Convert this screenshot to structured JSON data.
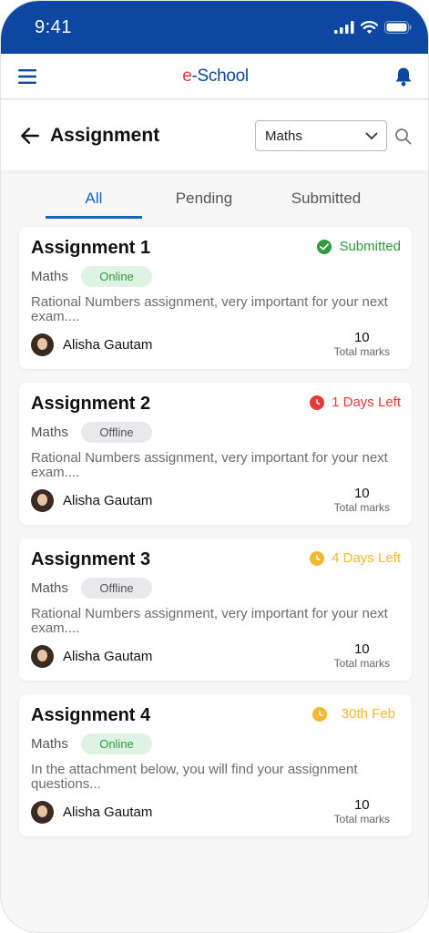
{
  "status_bar": {
    "time": "9:41"
  },
  "app": {
    "brand_e": "e",
    "brand_rest": "-School"
  },
  "header": {
    "title": "Assignment",
    "subject_select": "Maths"
  },
  "tabs": [
    {
      "label": "All",
      "active": true
    },
    {
      "label": "Pending",
      "active": false
    },
    {
      "label": "Submitted",
      "active": false
    }
  ],
  "assignments": [
    {
      "title": "Assignment 1",
      "status": "Submitted",
      "status_type": "submitted",
      "status_color": "#2e9b3c",
      "subject": "Maths",
      "mode": "Online",
      "description": "Rational Numbers assignment, very important for your next exam....",
      "teacher": "Alisha Gautam",
      "marks": "10",
      "marks_label": "Total marks"
    },
    {
      "title": "Assignment 2",
      "status": "1 Days Left",
      "status_type": "urgent",
      "status_color": "#e53935",
      "subject": "Maths",
      "mode": "Offline",
      "description": "Rational Numbers assignment, very important for your next exam....",
      "teacher": "Alisha Gautam",
      "marks": "10",
      "marks_label": "Total marks"
    },
    {
      "title": "Assignment 3",
      "status": "4 Days Left",
      "status_type": "pending",
      "status_color": "#f5b82e",
      "subject": "Maths",
      "mode": "Offline",
      "description": "Rational Numbers assignment, very important for your next exam....",
      "teacher": "Alisha Gautam",
      "marks": "10",
      "marks_label": "Total marks"
    },
    {
      "title": "Assignment 4",
      "status": "30th Feb",
      "status_type": "pending",
      "status_color": "#f5b82e",
      "subject": "Maths",
      "mode": "Online",
      "description": "In the attachment below, you will find your assignment questions...",
      "teacher": "Alisha Gautam",
      "marks": "10",
      "marks_label": "Total marks"
    }
  ],
  "colors": {
    "primary": "#0d47a1",
    "accent": "#1565c0",
    "brand_red": "#e53935"
  },
  "icons": [
    "signal-icon",
    "wifi-icon",
    "battery-icon",
    "menu-icon",
    "bell-icon",
    "back-arrow-icon",
    "chevron-down-icon",
    "search-icon",
    "check-circle-icon",
    "clock-icon"
  ]
}
